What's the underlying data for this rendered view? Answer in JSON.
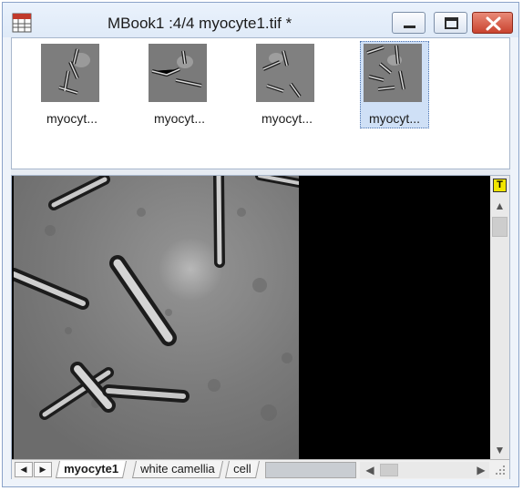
{
  "window": {
    "title": "MBook1 :4/4 myocyte1.tif *",
    "icons": {
      "app": "spreadsheet-app-icon",
      "minimize": "minimize-icon",
      "maximize": "maximize-icon",
      "close": "close-icon"
    }
  },
  "thumbnails": [
    {
      "label": "myocyt...",
      "selected": false
    },
    {
      "label": "myocyt...",
      "selected": false
    },
    {
      "label": "myocyt...",
      "selected": false
    },
    {
      "label": "myocyt...",
      "selected": true
    }
  ],
  "viewer": {
    "text_tool_label": "T",
    "scroll_up_glyph": "▲",
    "scroll_down_glyph": "▼",
    "scroll_left_glyph": "◀",
    "scroll_right_glyph": "▶"
  },
  "sheet_nav": {
    "prev_glyph": "◀",
    "next_glyph": "▶"
  },
  "tabs": [
    {
      "label": "myocyte1",
      "active": true
    },
    {
      "label": "white camellia",
      "active": false
    },
    {
      "label": "cell",
      "active": false
    }
  ],
  "colors": {
    "titlebar": "#dfeaf8",
    "close_button": "#c9432f",
    "selected_thumb": "#cfe0f6",
    "text_tool": "#f2e600"
  }
}
